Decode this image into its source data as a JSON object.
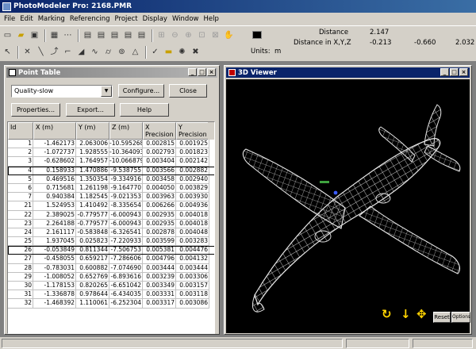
{
  "app": {
    "title": "PhotoModeler Pro: 2168.PMR"
  },
  "menu": [
    "File",
    "Edit",
    "Marking",
    "Referencing",
    "Project",
    "Display",
    "Window",
    "Help"
  ],
  "toolbar": {
    "row1": [
      "new-icon",
      "open-icon",
      "save-icon",
      "photos-icon",
      "dots-icon",
      "view1-icon",
      "view2-icon",
      "view3-icon",
      "view4-icon",
      "view5-icon",
      "zoom-fit-icon",
      "zoom-out-icon",
      "zoom-in-icon",
      "zoom-area-icon",
      "zoom-window-icon",
      "pan-icon",
      "units-icon"
    ],
    "row2": [
      "select-icon",
      "delete-icon",
      "line-icon",
      "curve-icon",
      "edge-icon",
      "surface-icon",
      "path-icon",
      "cylinder-icon",
      "target-icon",
      "triangle-icon",
      "point-icon",
      "tape-icon",
      "process-icon",
      "tools-icon"
    ]
  },
  "measure": {
    "distance_label": "Distance",
    "distance_value": "2.147",
    "xyz_label": "Distance in X,Y,Z",
    "x": "-0.213",
    "y": "-0.660",
    "z": "2.032",
    "units_label": "Units:",
    "units_value": "m"
  },
  "point_table": {
    "title": "Point Table",
    "filter_value": "Quality-slow",
    "configure_label": "Configure...",
    "close_label": "Close",
    "properties_label": "Properties...",
    "export_label": "Export...",
    "help_label": "Help",
    "columns": [
      "Id",
      "X (m)",
      "Y (m)",
      "Z (m)",
      "X Precision",
      "Y Precision"
    ],
    "rows": [
      [
        "1",
        "-1.462173",
        "2.063006",
        "-10.595268",
        "0.002815",
        "0.001925"
      ],
      [
        "2",
        "-1.072737",
        "1.928555",
        "-10.364093",
        "0.002793",
        "0.001823"
      ],
      [
        "3",
        "-0.628602",
        "1.764957",
        "-10.066879",
        "0.003404",
        "0.002142"
      ],
      [
        "4",
        "0.158933",
        "1.470886",
        "-9.538755",
        "0.003566",
        "0.002882"
      ],
      [
        "5",
        "0.469516",
        "1.350354",
        "-9.334916",
        "0.003458",
        "0.002940"
      ],
      [
        "6",
        "0.715681",
        "1.261198",
        "-9.164770",
        "0.004050",
        "0.003829"
      ],
      [
        "7",
        "0.940384",
        "1.182545",
        "-9.021353",
        "0.003963",
        "0.003930"
      ],
      [
        "21",
        "1.524953",
        "1.410492",
        "-8.335654",
        "0.006266",
        "0.004936"
      ],
      [
        "22",
        "2.389025",
        "-0.779577",
        "-6.000943",
        "0.002935",
        "0.004018"
      ],
      [
        "23",
        "2.264188",
        "-0.779577",
        "-6.000943",
        "0.002935",
        "0.004018"
      ],
      [
        "24",
        "2.161117",
        "-0.583848",
        "-6.326541",
        "0.002878",
        "0.004048"
      ],
      [
        "25",
        "1.937045",
        "0.025823",
        "-7.220933",
        "0.003599",
        "0.003283"
      ],
      [
        "26",
        "-0.053849",
        "0.811344",
        "-7.506753",
        "0.005381",
        "0.004476"
      ],
      [
        "27",
        "-0.458055",
        "0.659217",
        "-7.286606",
        "0.004796",
        "0.004132"
      ],
      [
        "28",
        "-0.783031",
        "0.600882",
        "-7.074690",
        "0.003444",
        "0.003444"
      ],
      [
        "29",
        "-1.008052",
        "0.652769",
        "-6.893616",
        "0.003239",
        "0.003306"
      ],
      [
        "30",
        "-1.178153",
        "0.820265",
        "-6.651042",
        "0.003349",
        "0.003157"
      ],
      [
        "31",
        "-1.336878",
        "0.978644",
        "-6.434035",
        "0.003331",
        "0.003118"
      ],
      [
        "32",
        "-1.468392",
        "1.110061",
        "-6.252304",
        "0.003317",
        "0.003086"
      ]
    ],
    "selected_ids": [
      "4",
      "26"
    ]
  },
  "viewer": {
    "title": "3D Viewer",
    "reset_label": "Reset",
    "options_label": "Options",
    "control_icons": [
      "rotate-icon",
      "zoom-arrow-icon",
      "pan-move-icon"
    ]
  },
  "colors": {
    "title_active": "#0a246a",
    "title_inactive": "#808080",
    "face": "#d4d0c8",
    "viewer_bg": "#000000",
    "wireframe": "#d8d8d8",
    "control": "#ffd400"
  }
}
